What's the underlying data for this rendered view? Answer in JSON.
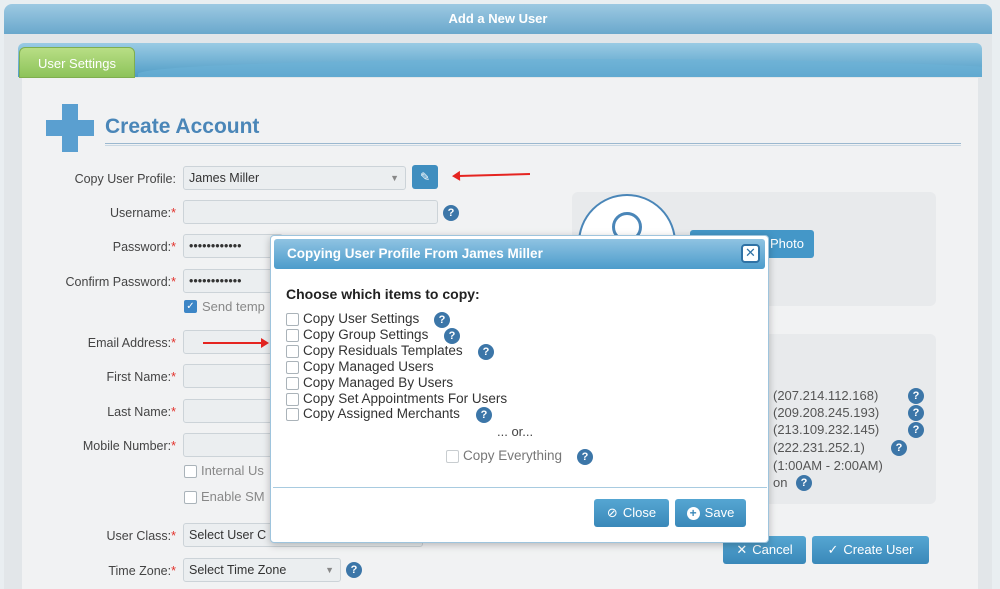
{
  "window": {
    "title": "Add a New User"
  },
  "tabs": [
    {
      "label": "User Settings"
    }
  ],
  "form": {
    "heading": "Create Account",
    "copy_profile": {
      "label": "Copy User Profile:",
      "value": "James Miller"
    },
    "username": {
      "label": "Username:",
      "value": ""
    },
    "password": {
      "label": "Password:",
      "value": "••••••••••••"
    },
    "confirm_password": {
      "label": "Confirm Password:",
      "value": "••••••••••••"
    },
    "send_temp": {
      "label": "Send temp",
      "checked": true
    },
    "email": {
      "label": "Email Address:",
      "value": ""
    },
    "first_name": {
      "label": "First Name:",
      "value": ""
    },
    "last_name": {
      "label": "Last Name:",
      "value": ""
    },
    "mobile": {
      "label": "Mobile Number:",
      "value": ""
    },
    "internal_user": {
      "label": "Internal Us",
      "checked": false
    },
    "enable_sms": {
      "label": "Enable SM",
      "checked": false
    },
    "user_class": {
      "label": "User Class:",
      "value": "Select User C"
    },
    "time_zone": {
      "label": "Time Zone:",
      "value": "Select Time Zone"
    },
    "required_mark": "*"
  },
  "photo": {
    "button_label": "Photo"
  },
  "ip_list": [
    "(207.214.112.168)",
    "(209.208.245.193)",
    "(213.109.232.145)",
    "(222.231.252.1)",
    "(1:00AM - 2:00AM)",
    "on"
  ],
  "actions": {
    "cancel": "Cancel",
    "create": "Create User"
  },
  "modal": {
    "title": "Copying User Profile From James Miller",
    "subtitle": "Choose which items to copy:",
    "options": [
      {
        "label": "Copy User Settings",
        "help": true,
        "checked": false
      },
      {
        "label": "Copy Group Settings",
        "help": true,
        "checked": false
      },
      {
        "label": "Copy Residuals Templates",
        "help": true,
        "checked": false
      },
      {
        "label": "Copy Managed Users",
        "help": false,
        "checked": false
      },
      {
        "label": "Copy Managed By Users",
        "help": false,
        "checked": false
      },
      {
        "label": "Copy Set Appointments For Users",
        "help": false,
        "checked": false
      },
      {
        "label": "Copy Assigned Merchants",
        "help": true,
        "checked": false
      }
    ],
    "or_text": "... or...",
    "copy_everything": "Copy Everything",
    "close_label": "Close",
    "save_label": "Save"
  },
  "icons": {
    "help": "?",
    "close": "✕",
    "edit": "✎",
    "check": "✓",
    "circle_slash": "⊘",
    "plus": "+"
  },
  "colors": {
    "accent": "#4a86b8",
    "button": "#3a88b9",
    "required": "#e2312b",
    "tab_active": "#8dc35a"
  }
}
